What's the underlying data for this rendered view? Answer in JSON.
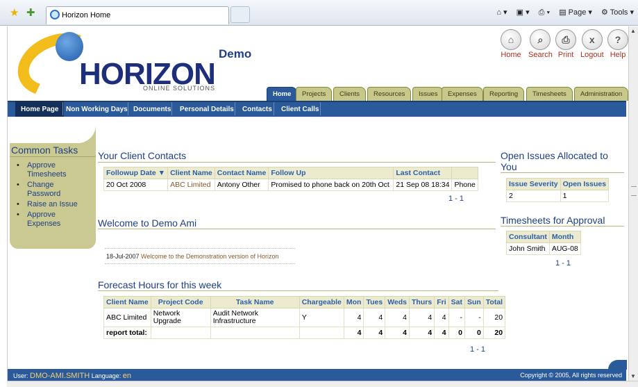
{
  "browser": {
    "tab_title": "Horizon Home",
    "tools": [
      "Page",
      "Tools"
    ]
  },
  "header": {
    "logo_text": "HORIZON",
    "logo_sub": "ONLINE SOLUTIONS",
    "demo": "Demo",
    "top_icons": [
      {
        "label": "Home",
        "icon": "home-icon"
      },
      {
        "label": "Search",
        "icon": "search-icon"
      },
      {
        "label": "Print",
        "icon": "print-icon"
      },
      {
        "label": "Logout",
        "icon": "logout-icon"
      },
      {
        "label": "Help",
        "icon": "help-icon"
      }
    ]
  },
  "tabs": [
    "Home",
    "Projects",
    "Clients",
    "Resources",
    "Issues",
    "Expenses",
    "Reporting",
    "Timesheets",
    "Administration"
  ],
  "subnav": [
    "Home Page",
    "Non Working Days",
    "Documents",
    "Personal Details",
    "Contacts",
    "Client Calls"
  ],
  "common_tasks": {
    "title": "Common Tasks",
    "items": [
      "Approve Timesheets",
      "Change Password",
      "Raise an Issue",
      "Approve Expenses"
    ]
  },
  "client_contacts": {
    "title": "Your Client Contacts",
    "headers": [
      "Followup Date ▼",
      "Client Name",
      "Contact Name",
      "Follow Up",
      "Last Contact",
      ""
    ],
    "rows": [
      [
        "20 Oct 2008",
        "ABC Limited",
        "Antony Other",
        "Promised to phone back on 20th Oct",
        "21 Sep 08 18:34",
        "Phone"
      ]
    ],
    "pager": "1 - 1"
  },
  "welcome": {
    "title": "Welcome to Demo Ami",
    "date": "18-Jul-2007",
    "message": "Welcome to the Demonstration version of Horizon"
  },
  "forecast": {
    "title": "Forecast Hours for this week",
    "headers": [
      "Client Name",
      "Project Code",
      "Task Name",
      "Chargeable",
      "Mon",
      "Tues",
      "Weds",
      "Thurs",
      "Fri",
      "Sat",
      "Sun",
      "Total"
    ],
    "row": {
      "client": "ABC Limited",
      "project": "Network Upgrade",
      "task": "Audit Network Infrastructure",
      "chargeable": "Y",
      "mon": "4",
      "tues": "4",
      "weds": "4",
      "thurs": "4",
      "fri": "4",
      "sat": "-",
      "sun": "-",
      "total": "20"
    },
    "total_row": {
      "label": "report total:",
      "mon": "4",
      "tues": "4",
      "weds": "4",
      "thurs": "4",
      "fri": "4",
      "sat": "0",
      "sun": "0",
      "total": "20"
    },
    "pager": "1 - 1"
  },
  "open_issues": {
    "title": "Open Issues Allocated to You",
    "headers": [
      "Issue Severity",
      "Open Issues"
    ],
    "rows": [
      [
        "2",
        "1"
      ]
    ]
  },
  "timesheets": {
    "title": "Timesheets for Approval",
    "headers": [
      "Consultant",
      "Month"
    ],
    "rows": [
      [
        "John Smith",
        "AUG-08"
      ]
    ],
    "pager": "1 - 1"
  },
  "footer": {
    "user_label": "User:",
    "user": "DMO-AMI.SMITH",
    "lang_label": "Language:",
    "lang": "en",
    "copyright": "Copyright © 2005, All rights reserved"
  },
  "colors": {
    "nav_blue": "#2a5a9a",
    "panel_olive": "#cac992",
    "title_blue": "#1e3f86",
    "accent_gold": "#f2bc1b"
  }
}
